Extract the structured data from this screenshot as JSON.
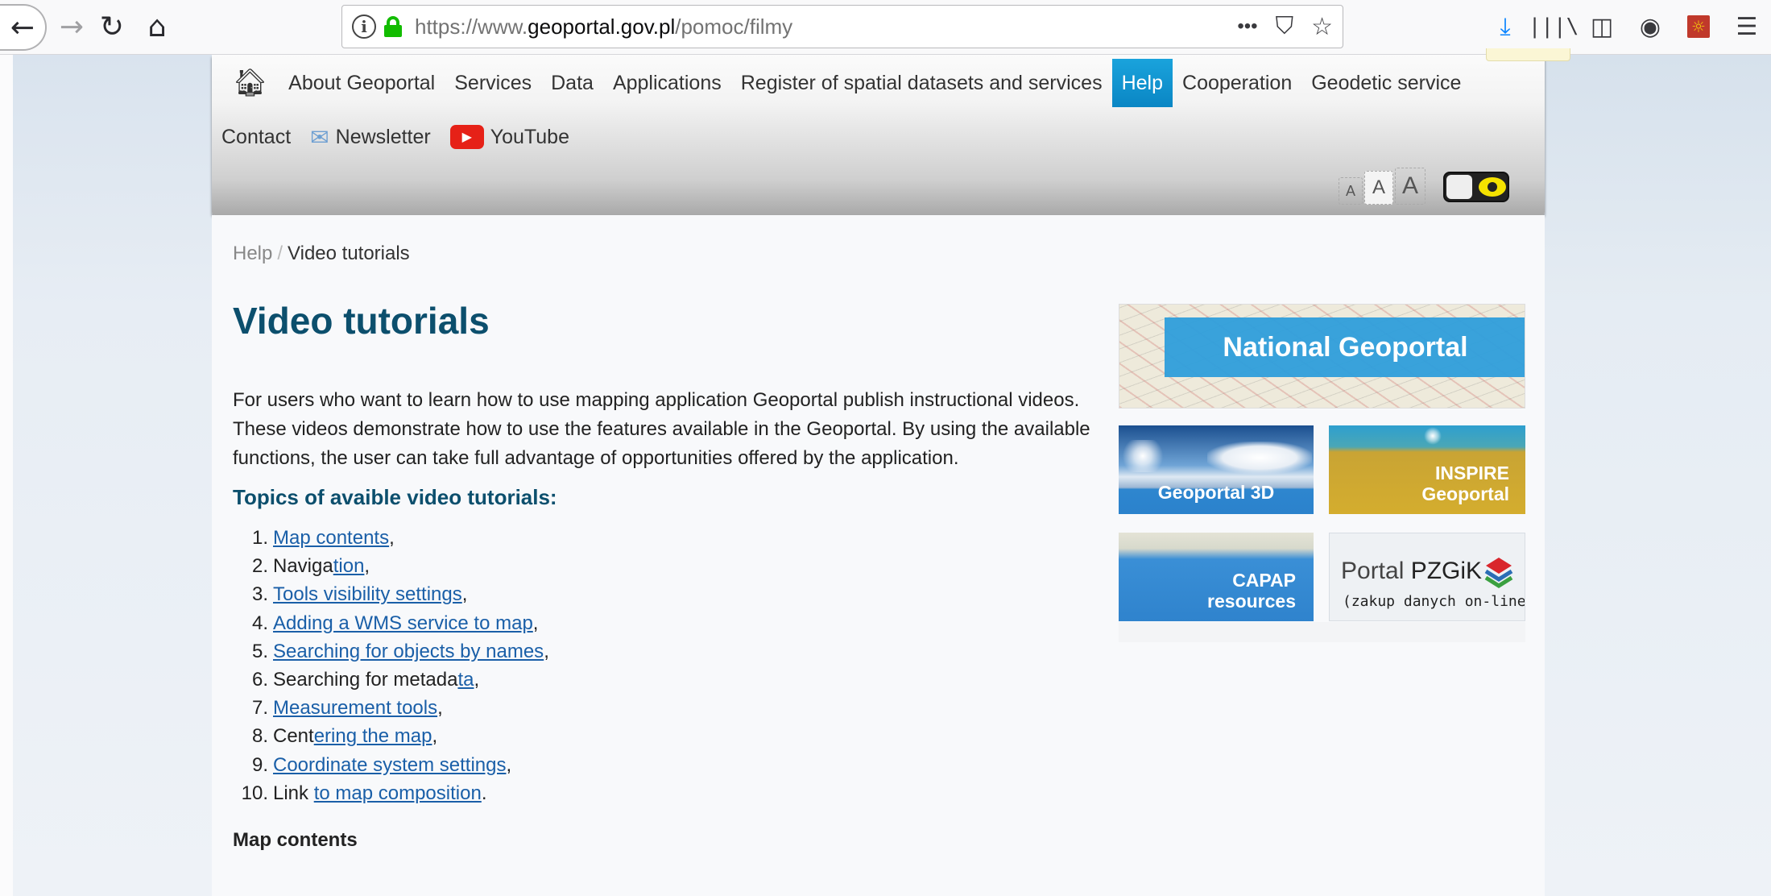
{
  "browser": {
    "url_prefix": "https://www.",
    "url_domain": "geoportal.gov.pl",
    "url_path": "/pomoc/filmy",
    "more_icon": "•••",
    "pocket_icon": "⛉",
    "star_icon": "☆"
  },
  "menu": {
    "row1": [
      "About Geoportal",
      "Services",
      "Data",
      "Applications",
      "Register of spatial datasets and services",
      "Help",
      "Cooperation",
      "Geodetic service"
    ],
    "active_item": "Help",
    "contact": "Contact",
    "newsletter": "Newsletter",
    "youtube": "YouTube",
    "font_sizes": [
      "A",
      "A",
      "A"
    ]
  },
  "breadcrumb": {
    "parent": "Help",
    "separator": "/",
    "current": "Video tutorials"
  },
  "page": {
    "title": "Video tutorials",
    "intro": "For users who want to learn how to use mapping application Geoportal publish instructional videos. These videos demonstrate how to use the features available in the Geoportal. By using the available functions, the user can take full advantage of opportunities offered by the application.",
    "topics_heading": "Topics of avaible video tutorials:",
    "topics": [
      {
        "num": "1.",
        "pre": "",
        "link": "Map contents",
        "post": ","
      },
      {
        "num": "2.",
        "pre": "Naviga",
        "link": "tion",
        "post": ","
      },
      {
        "num": "3.",
        "pre": "",
        "link": "Tools visibility settings",
        "post": ","
      },
      {
        "num": "4.",
        "pre": "",
        "link": "Adding a WMS service to map",
        "post": ","
      },
      {
        "num": "5.",
        "pre": "",
        "link": "Searching for objects by names",
        "post": ","
      },
      {
        "num": "6.",
        "pre": "Searching for metada",
        "link": "ta",
        "post": ","
      },
      {
        "num": "7.",
        "pre": "",
        "link": "Measurement tools",
        "post": ","
      },
      {
        "num": "8.",
        "pre": "Cent",
        "link": "ering the map",
        "post": ","
      },
      {
        "num": "9.",
        "pre": "",
        "link": "Coordinate system settings",
        "post": ","
      },
      {
        "num": "10.",
        "pre": "Link ",
        "link": "to map composition",
        "post": "."
      }
    ],
    "section_subheading": "Map contents"
  },
  "banners": {
    "geoportal": "National Geoportal",
    "geoportal3d": "Geoportal 3D",
    "inspire_line1": "INSPIRE",
    "inspire_line2": "Geoportal",
    "capap_line1": "CAPAP",
    "capap_line2": "resources",
    "pzgik_light": "Portal ",
    "pzgik_strong": "PZGiK",
    "pzgik_sub": "(zakup danych on-line)"
  }
}
